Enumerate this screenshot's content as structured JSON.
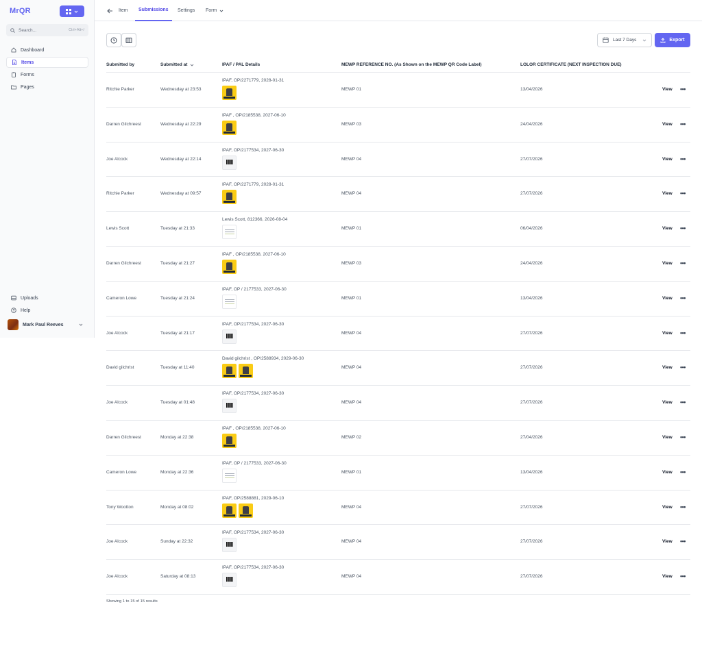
{
  "sidebar": {
    "logo": "MrQR",
    "search": {
      "placeholder": "Search...",
      "shortcut": "Ctrl+Alt+/"
    },
    "nav": [
      {
        "label": "Dashboard",
        "icon": "home-icon"
      },
      {
        "label": "Items",
        "icon": "document-icon",
        "active": true
      },
      {
        "label": "Forms",
        "icon": "clipboard-icon"
      },
      {
        "label": "Pages",
        "icon": "folder-icon"
      }
    ],
    "bottom_nav": [
      {
        "label": "Uploads",
        "icon": "upload-box-icon"
      },
      {
        "label": "Help",
        "icon": "help-circle-icon"
      }
    ],
    "user": {
      "name": "Mark Paul Reeves"
    }
  },
  "topbar": {
    "back_label": "Item",
    "tabs": [
      {
        "label": "Submissions",
        "active": true
      },
      {
        "label": "Settings"
      },
      {
        "label": "Form"
      }
    ]
  },
  "toolbar": {
    "date_range": "Last 7 Days",
    "export_label": "Export"
  },
  "table": {
    "columns": [
      "Submitted by",
      "Submitted at",
      "IPAF / PAL Details",
      "MEWP REFERENCE NO. (As Shown on the MEWP QR Code Label)",
      "LOLOR CERTIFICATE (NEXT INSPECTION DUE)"
    ],
    "action_label": "View",
    "rows": [
      {
        "by": "Ritchie Parker",
        "at": "Wednesday at 23:53",
        "ipaf": "IPAF, OP/2271779, 2028-01-31",
        "thumbs": [
          "yellow"
        ],
        "mewp": "MEWP 01",
        "lolor": "13/04/2026"
      },
      {
        "by": "Darren Gilchreest",
        "at": "Wednesday at 22:29",
        "ipaf": "IPAF , OP/2185538, 2027-06-10",
        "thumbs": [
          "yellow"
        ],
        "mewp": "MEWP 03",
        "lolor": "24/04/2026"
      },
      {
        "by": "Joe Alcock",
        "at": "Wednesday at 22:14",
        "ipaf": "IPAF, OP/2177534, 2027-06-30",
        "thumbs": [
          "gray"
        ],
        "mewp": "MEWP 04",
        "lolor": "27/07/2026"
      },
      {
        "by": "Ritchie Parker",
        "at": "Wednesday at 09:57",
        "ipaf": "IPAF, OP/2271779, 2028-01-31",
        "thumbs": [
          "yellow"
        ],
        "mewp": "MEWP 04",
        "lolor": "27/07/2026"
      },
      {
        "by": "Lewis Scott",
        "at": "Tuesday at 21:33",
        "ipaf": "Lewis Scott, 812366, 2026-08-04",
        "thumbs": [
          "white"
        ],
        "mewp": "MEWP 01",
        "lolor": "06/04/2026"
      },
      {
        "by": "Darren Gilchreest",
        "at": "Tuesday at 21:27",
        "ipaf": "IPAF , OP/2185538, 2027-06-10",
        "thumbs": [
          "yellow"
        ],
        "mewp": "MEWP 03",
        "lolor": "24/04/2026"
      },
      {
        "by": "Cameron Lowe",
        "at": "Tuesday at 21:24",
        "ipaf": "IPAF, OP / 2177533, 2027-06-30",
        "thumbs": [
          "white"
        ],
        "mewp": "MEWP 01",
        "lolor": "13/04/2026"
      },
      {
        "by": "Joe Alcock",
        "at": "Tuesday at 21:17",
        "ipaf": "IPAF, OP/2177534, 2027-06-30",
        "thumbs": [
          "gray"
        ],
        "mewp": "MEWP 04",
        "lolor": "27/07/2026"
      },
      {
        "by": "David gilchrist",
        "at": "Tuesday at 11:40",
        "ipaf": "David gilchrist , OP/2588934, 2029-06-30",
        "thumbs": [
          "yellow",
          "yellow"
        ],
        "mewp": "MEWP 04",
        "lolor": "27/07/2026"
      },
      {
        "by": "Joe Alcock",
        "at": "Tuesday at 01:48",
        "ipaf": "IPAF, OP/2177534, 2027-06-30",
        "thumbs": [
          "gray"
        ],
        "mewp": "MEWP 04",
        "lolor": "27/07/2026"
      },
      {
        "by": "Darren Gilchreest",
        "at": "Monday at 22:38",
        "ipaf": "IPAF , OP/2185538, 2027-06-10",
        "thumbs": [
          "yellow"
        ],
        "mewp": "MEWP 02",
        "lolor": "27/04/2026"
      },
      {
        "by": "Cameron Lowe",
        "at": "Monday at 22:36",
        "ipaf": "IPAF, OP / 2177533, 2027-06-30",
        "thumbs": [
          "white"
        ],
        "mewp": "MEWP 01",
        "lolor": "13/04/2026"
      },
      {
        "by": "Tony Wootton",
        "at": "Monday at 08:02",
        "ipaf": "IPAF, OP/2588881, 2029-06-10",
        "thumbs": [
          "yellow",
          "yellow"
        ],
        "mewp": "MEWP 04",
        "lolor": "27/07/2026"
      },
      {
        "by": "Joe Alcock",
        "at": "Sunday at 22:32",
        "ipaf": "IPAF, OP/2177534, 2027-06-30",
        "thumbs": [
          "gray"
        ],
        "mewp": "MEWP 04",
        "lolor": "27/07/2026"
      },
      {
        "by": "Joe Alcock",
        "at": "Saturday at 08:13",
        "ipaf": "IPAF, OP/2177534, 2027-06-30",
        "thumbs": [
          "gray"
        ],
        "mewp": "MEWP 04",
        "lolor": "27/07/2026"
      }
    ]
  },
  "footer": {
    "results": "Showing 1 to 15 of 15 results"
  },
  "colors": {
    "accent": "#6366f1",
    "accent_dark": "#4f46e5",
    "border": "#e5e7eb"
  }
}
